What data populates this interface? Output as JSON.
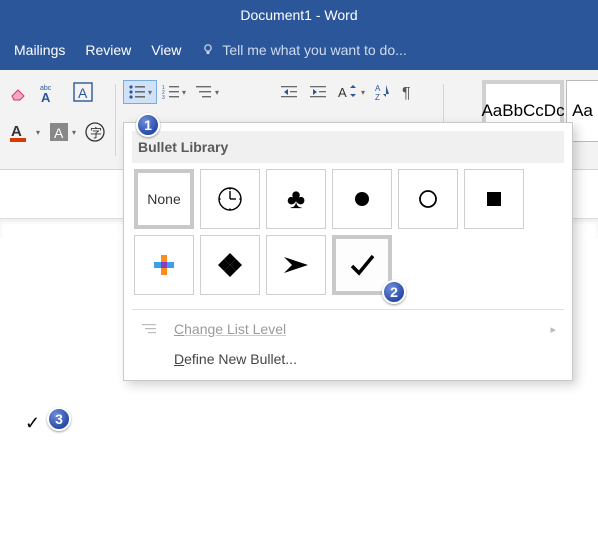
{
  "title": "Document1 - Word",
  "tabs": {
    "mailings": "Mailings",
    "review": "Review",
    "view": "View"
  },
  "tellme": "Tell me what you want to do...",
  "styles": {
    "normal": "AaBbCcDc",
    "cut": "Aa"
  },
  "dropdown": {
    "header": "Bullet Library",
    "none": "None",
    "change_level": "Change List Level",
    "define_new": "Define New Bullet..."
  },
  "badges": {
    "one": "1",
    "two": "2",
    "three": "3"
  }
}
